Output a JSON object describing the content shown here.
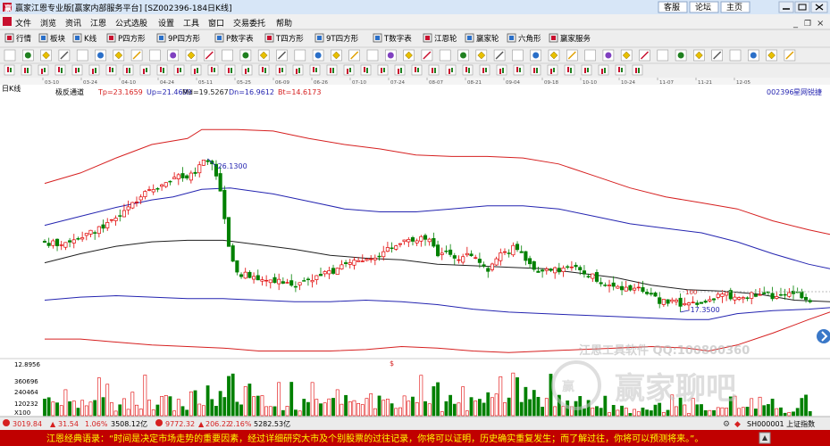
{
  "window": {
    "title": "赢家江恩专业版[赢家内部服务平台] [SZ002396-184日K线]",
    "buttons": [
      "客服",
      "论坛",
      "主页"
    ],
    "window_controls": [
      "minimize-icon",
      "maximize-icon",
      "close-icon"
    ]
  },
  "menu": [
    "文件",
    "浏览",
    "资讯",
    "江恩",
    "公式选股",
    "设置",
    "工具",
    "窗口",
    "交易委托",
    "帮助"
  ],
  "toolbar_tabs": [
    "行情",
    "板块",
    "K线",
    "P四方形",
    "9P四方形",
    "P数字表",
    "T四方形",
    "9T四方形",
    "T数字表",
    "江恩轮",
    "赢家轮",
    "六角形",
    "赢家服务"
  ],
  "chart_header": {
    "period": "日K线",
    "indicator": "极反通道",
    "values": [
      "Tp=23.1659",
      "Up=21.4699",
      "Md=19.5267",
      "Dn=16.9612",
      "Bt=14.6173"
    ],
    "stock_code": "002396",
    "stock_name": "星网锐捷",
    "date_ticks": [
      "03-10",
      "03-24",
      "04-10",
      "04-24",
      "05-11",
      "05-25",
      "06-09",
      "06-26",
      "07-10",
      "07-24",
      "08-07",
      "08-21",
      "09-04",
      "09-18",
      "10-10",
      "10-24",
      "11-07",
      "11-21",
      "12-05"
    ]
  },
  "price_labels": {
    "high": "26.1300",
    "low": "17.3500"
  },
  "volume_labels": [
    "12.8956",
    "360696",
    "240464",
    "120232",
    "X100"
  ],
  "watermark": {
    "line1": "江恩工具软件  QQ:100800360",
    "line2": "赢家聊吧"
  },
  "status_bar": {
    "sh_index": "3019.84",
    "sh_change": "31.54",
    "sh_pct": "1.06%",
    "sh_amount": "3508.12亿",
    "sz_index": "9772.32",
    "sz_change": "206.22",
    "sz_pct": "2.16%",
    "sz_amount": "5282.53亿",
    "ticker": "SH000001 上证指数"
  },
  "footer_quote": "江恩经典语录：“时间是决定市场走势的重要因素，经过详细研究大市及个别股票的过往记录，你将可以证明，历史确实重复发生；而了解过往，你将可以预测将来。”。",
  "colors": {
    "up": "#e00000",
    "down": "#008000",
    "band_outer": "#d62020",
    "band_inner": "#2424b0",
    "mid_line": "#202020",
    "title_bar": "#d7e6f7",
    "menu_bg": "#f0f0f0",
    "footer_bg": "#c00000",
    "footer_text": "#ffff00"
  },
  "chart_data": {
    "type": "candlestick",
    "title": "",
    "x_count": 184,
    "ylim": [
      12.8956,
      30.3
    ],
    "price_path": [
      [
        0,
        20.6
      ],
      [
        6,
        20.5
      ],
      [
        12,
        21.2
      ],
      [
        18,
        22.0
      ],
      [
        22,
        22.8
      ],
      [
        26,
        23.6
      ],
      [
        30,
        24.2
      ],
      [
        34,
        24.8
      ],
      [
        38,
        25.0
      ],
      [
        42,
        25.3
      ],
      [
        44,
        25.9
      ],
      [
        46,
        26.1
      ],
      [
        48,
        25.2
      ],
      [
        50,
        23.0
      ],
      [
        52,
        19.8
      ],
      [
        54,
        18.7
      ],
      [
        58,
        18.3
      ],
      [
        62,
        18.2
      ],
      [
        66,
        18.0
      ],
      [
        70,
        17.9
      ],
      [
        74,
        18.0
      ],
      [
        78,
        18.6
      ],
      [
        82,
        18.8
      ],
      [
        86,
        19.3
      ],
      [
        90,
        19.5
      ],
      [
        94,
        19.9
      ],
      [
        98,
        20.3
      ],
      [
        102,
        20.8
      ],
      [
        106,
        20.9
      ],
      [
        108,
        21.0
      ],
      [
        110,
        19.8
      ],
      [
        112,
        20.2
      ],
      [
        116,
        19.6
      ],
      [
        120,
        19.9
      ],
      [
        124,
        18.9
      ],
      [
        128,
        19.8
      ],
      [
        132,
        20.4
      ],
      [
        136,
        19.0
      ],
      [
        140,
        18.7
      ],
      [
        144,
        18.8
      ],
      [
        148,
        18.9
      ],
      [
        152,
        18.6
      ],
      [
        156,
        18.0
      ],
      [
        160,
        17.8
      ],
      [
        164,
        17.5
      ],
      [
        168,
        17.4
      ],
      [
        172,
        16.7
      ],
      [
        176,
        16.6
      ],
      [
        180,
        16.6
      ],
      [
        184,
        16.7
      ],
      [
        190,
        17.2
      ],
      [
        195,
        16.8
      ],
      [
        200,
        17.3
      ],
      [
        205,
        17.0
      ],
      [
        210,
        17.4
      ],
      [
        214,
        16.6
      ],
      [
        218,
        15.4
      ],
      [
        220,
        15.5
      ]
    ],
    "seed": 11,
    "bands": [
      {
        "name": "Tp",
        "color": "#d62020",
        "points": [
          [
            0,
            24.6
          ],
          [
            10,
            25.3
          ],
          [
            20,
            26.3
          ],
          [
            30,
            27.2
          ],
          [
            40,
            27.6
          ],
          [
            44,
            28.2
          ],
          [
            54,
            28.2
          ],
          [
            64,
            28.1
          ],
          [
            74,
            27.6
          ],
          [
            84,
            27.2
          ],
          [
            94,
            26.9
          ],
          [
            104,
            26.5
          ],
          [
            114,
            26.4
          ],
          [
            124,
            26.4
          ],
          [
            134,
            26.3
          ],
          [
            144,
            25.9
          ],
          [
            154,
            25.1
          ],
          [
            164,
            24.3
          ],
          [
            174,
            23.7
          ],
          [
            184,
            23.3
          ],
          [
            194,
            22.9
          ],
          [
            204,
            22.1
          ],
          [
            214,
            21.5
          ],
          [
            220,
            21.2
          ]
        ]
      },
      {
        "name": "Up",
        "color": "#2424b0",
        "points": [
          [
            0,
            21.8
          ],
          [
            10,
            22.4
          ],
          [
            20,
            23.0
          ],
          [
            30,
            23.5
          ],
          [
            36,
            23.7
          ],
          [
            44,
            24.2
          ],
          [
            52,
            24.3
          ],
          [
            64,
            23.9
          ],
          [
            74,
            23.4
          ],
          [
            84,
            22.9
          ],
          [
            94,
            22.7
          ],
          [
            104,
            22.7
          ],
          [
            114,
            22.9
          ],
          [
            124,
            23.1
          ],
          [
            134,
            23.1
          ],
          [
            144,
            22.9
          ],
          [
            154,
            22.4
          ],
          [
            164,
            21.9
          ],
          [
            174,
            21.6
          ],
          [
            184,
            21.3
          ],
          [
            194,
            20.7
          ],
          [
            204,
            19.9
          ],
          [
            214,
            19.2
          ],
          [
            220,
            18.9
          ]
        ]
      },
      {
        "name": "Md",
        "color": "#202020",
        "points": [
          [
            0,
            19.3
          ],
          [
            10,
            19.9
          ],
          [
            20,
            20.4
          ],
          [
            30,
            20.7
          ],
          [
            40,
            20.8
          ],
          [
            50,
            20.8
          ],
          [
            60,
            20.5
          ],
          [
            70,
            20.2
          ],
          [
            80,
            19.8
          ],
          [
            90,
            19.6
          ],
          [
            100,
            19.5
          ],
          [
            110,
            19.2
          ],
          [
            120,
            19.1
          ],
          [
            130,
            19.0
          ],
          [
            140,
            18.9
          ],
          [
            150,
            18.6
          ],
          [
            160,
            18.3
          ],
          [
            170,
            17.8
          ],
          [
            180,
            17.5
          ],
          [
            190,
            17.4
          ],
          [
            200,
            17.2
          ],
          [
            210,
            16.8
          ],
          [
            220,
            16.7
          ]
        ]
      },
      {
        "name": "Dn",
        "color": "#2424b0",
        "points": [
          [
            0,
            16.8
          ],
          [
            10,
            17.0
          ],
          [
            20,
            17.1
          ],
          [
            30,
            17.0
          ],
          [
            40,
            16.9
          ],
          [
            50,
            16.9
          ],
          [
            60,
            16.8
          ],
          [
            70,
            16.7
          ],
          [
            80,
            16.7
          ],
          [
            90,
            16.8
          ],
          [
            100,
            16.7
          ],
          [
            110,
            16.5
          ],
          [
            120,
            16.2
          ],
          [
            130,
            16.0
          ],
          [
            140,
            15.9
          ],
          [
            150,
            15.8
          ],
          [
            160,
            15.7
          ],
          [
            170,
            15.6
          ],
          [
            180,
            15.5
          ],
          [
            186,
            15.5
          ],
          [
            194,
            15.9
          ],
          [
            204,
            16.1
          ],
          [
            214,
            16.2
          ],
          [
            220,
            16.3
          ]
        ]
      },
      {
        "name": "Bt",
        "color": "#d62020",
        "points": [
          [
            0,
            14.2
          ],
          [
            10,
            14.2
          ],
          [
            20,
            14.0
          ],
          [
            30,
            13.8
          ],
          [
            40,
            13.7
          ],
          [
            50,
            13.6
          ],
          [
            60,
            13.4
          ],
          [
            70,
            13.4
          ],
          [
            80,
            13.4
          ],
          [
            90,
            13.5
          ],
          [
            100,
            13.7
          ],
          [
            110,
            13.6
          ],
          [
            120,
            13.4
          ],
          [
            130,
            13.3
          ],
          [
            140,
            13.4
          ],
          [
            150,
            13.5
          ],
          [
            160,
            13.6
          ],
          [
            170,
            13.7
          ],
          [
            180,
            13.6
          ],
          [
            186,
            13.4
          ],
          [
            194,
            13.8
          ],
          [
            204,
            14.6
          ],
          [
            214,
            15.5
          ],
          [
            220,
            16.0
          ]
        ]
      }
    ],
    "volume_max": 480000,
    "volume_ticks": [
      360696,
      240464,
      120232
    ]
  }
}
